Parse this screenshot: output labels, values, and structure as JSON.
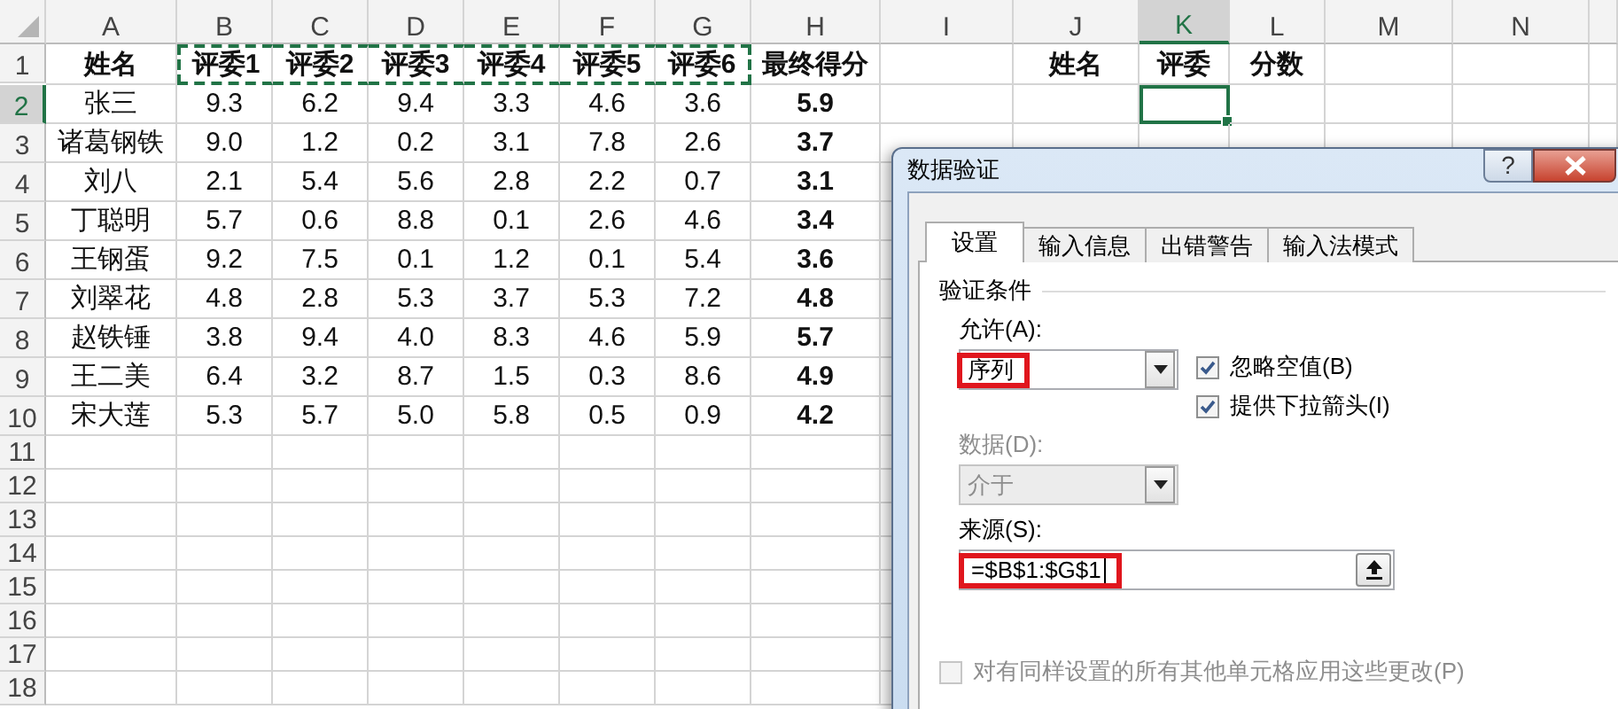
{
  "spreadsheet": {
    "columns": [
      {
        "label": "A",
        "selected": false
      },
      {
        "label": "B",
        "selected": false
      },
      {
        "label": "C",
        "selected": false
      },
      {
        "label": "D",
        "selected": false
      },
      {
        "label": "E",
        "selected": false
      },
      {
        "label": "F",
        "selected": false
      },
      {
        "label": "G",
        "selected": false
      },
      {
        "label": "H",
        "selected": false
      },
      {
        "label": "I",
        "selected": false
      },
      {
        "label": "J",
        "selected": false
      },
      {
        "label": "K",
        "selected": true
      },
      {
        "label": "L",
        "selected": false
      },
      {
        "label": "M",
        "selected": false
      },
      {
        "label": "N",
        "selected": false
      }
    ],
    "rows": [
      {
        "label": "1",
        "selected": false
      },
      {
        "label": "2",
        "selected": true
      },
      {
        "label": "3",
        "selected": false
      },
      {
        "label": "4",
        "selected": false
      },
      {
        "label": "5",
        "selected": false
      },
      {
        "label": "6",
        "selected": false
      },
      {
        "label": "7",
        "selected": false
      },
      {
        "label": "8",
        "selected": false
      },
      {
        "label": "9",
        "selected": false
      },
      {
        "label": "10",
        "selected": false
      },
      {
        "label": "11",
        "selected": false
      },
      {
        "label": "12",
        "selected": false
      },
      {
        "label": "13",
        "selected": false
      },
      {
        "label": "14",
        "selected": false
      },
      {
        "label": "15",
        "selected": false
      },
      {
        "label": "16",
        "selected": false
      },
      {
        "label": "17",
        "selected": false
      },
      {
        "label": "18",
        "selected": false
      }
    ],
    "score_table": {
      "header": [
        {
          "text": "姓名",
          "marquee": false
        },
        {
          "text": "评委1",
          "marquee": true
        },
        {
          "text": "评委2",
          "marquee": true
        },
        {
          "text": "评委3",
          "marquee": true
        },
        {
          "text": "评委4",
          "marquee": true
        },
        {
          "text": "评委5",
          "marquee": true
        },
        {
          "text": "评委6",
          "marquee": true
        },
        {
          "text": "最终得分",
          "marquee": false
        }
      ],
      "rows": [
        {
          "name": "张三",
          "scores": [
            "9.3",
            "6.2",
            "9.4",
            "3.3",
            "4.6",
            "3.6"
          ],
          "final": "5.9"
        },
        {
          "name": "诸葛钢铁",
          "scores": [
            "9.0",
            "1.2",
            "0.2",
            "3.1",
            "7.8",
            "2.6"
          ],
          "final": "3.7"
        },
        {
          "name": "刘八",
          "scores": [
            "2.1",
            "5.4",
            "5.6",
            "2.8",
            "2.2",
            "0.7"
          ],
          "final": "3.1"
        },
        {
          "name": "丁聪明",
          "scores": [
            "5.7",
            "0.6",
            "8.8",
            "0.1",
            "2.6",
            "4.6"
          ],
          "final": "3.4"
        },
        {
          "name": "王钢蛋",
          "scores": [
            "9.2",
            "7.5",
            "0.1",
            "1.2",
            "0.1",
            "5.4"
          ],
          "final": "3.6"
        },
        {
          "name": "刘翠花",
          "scores": [
            "4.8",
            "2.8",
            "5.3",
            "3.7",
            "5.3",
            "7.2"
          ],
          "final": "4.8"
        },
        {
          "name": "赵铁锤",
          "scores": [
            "3.8",
            "9.4",
            "4.0",
            "8.3",
            "4.6",
            "5.9"
          ],
          "final": "5.7"
        },
        {
          "name": "王二美",
          "scores": [
            "6.4",
            "3.2",
            "8.7",
            "1.5",
            "0.3",
            "8.6"
          ],
          "final": "4.9"
        },
        {
          "name": "宋大莲",
          "scores": [
            "5.3",
            "5.7",
            "5.0",
            "5.8",
            "0.5",
            "0.9"
          ],
          "final": "4.2"
        }
      ]
    },
    "lookup": {
      "header": [
        "姓名",
        "评委",
        "分数"
      ],
      "cells": [
        {
          "selected": false
        },
        {
          "selected": true
        },
        {
          "selected": false
        }
      ]
    }
  },
  "dialog": {
    "title": "数据验证",
    "help_button": "?",
    "tabs": [
      {
        "label": "设置",
        "selected": true
      },
      {
        "label": "输入信息",
        "selected": false
      },
      {
        "label": "出错警告",
        "selected": false
      },
      {
        "label": "输入法模式",
        "selected": false
      }
    ],
    "section": "验证条件",
    "allow": {
      "label": "允许(A):",
      "value": "序列",
      "highlighted": true
    },
    "options": [
      {
        "label": "忽略空值(B)",
        "checked": true
      },
      {
        "label": "提供下拉箭头(I)",
        "checked": true
      }
    ],
    "data": {
      "label": "数据(D):",
      "value": "介于",
      "disabled": true
    },
    "source": {
      "label": "来源(S):",
      "value": "=$B$1:$G$1",
      "highlighted": true
    },
    "apply_all": {
      "label": "对有同样设置的所有其他单元格应用这些更改(P)",
      "checked": false,
      "disabled": true
    }
  }
}
